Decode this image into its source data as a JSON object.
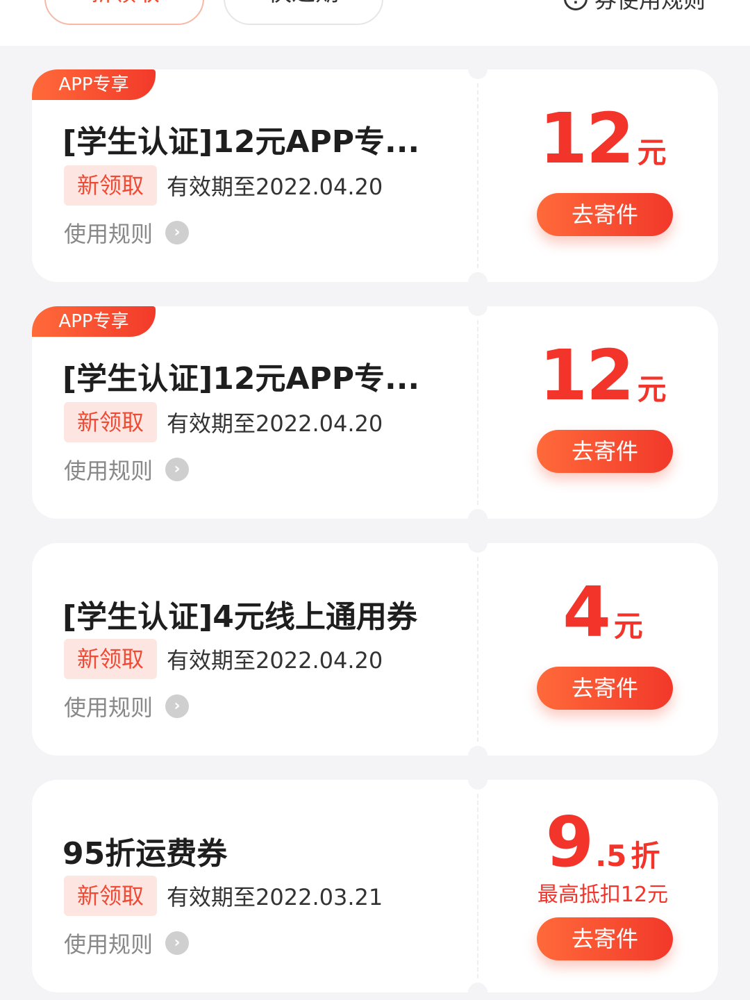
{
  "filters": {
    "new": "新领取",
    "expiring": "快过期"
  },
  "top_rules": {
    "label": "券使用规则",
    "icon": "info-icon"
  },
  "coupons": [
    {
      "badge": "APP专享",
      "title": "[学生认证]12元APP专...",
      "tag": "新领取",
      "expiry": "有效期至2022.04.20",
      "rules": "使用规则",
      "amount": "12",
      "unit": "元",
      "button": "去寄件"
    },
    {
      "badge": "APP专享",
      "title": "[学生认证]12元APP专...",
      "tag": "新领取",
      "expiry": "有效期至2022.04.20",
      "rules": "使用规则",
      "amount": "12",
      "unit": "元",
      "button": "去寄件"
    },
    {
      "title": "[学生认证]4元线上通用券",
      "tag": "新领取",
      "expiry": "有效期至2022.04.20",
      "rules": "使用规则",
      "amount": "4",
      "unit": "元",
      "button": "去寄件"
    },
    {
      "title": "95折运费券",
      "tag": "新领取",
      "expiry": "有效期至2022.03.21",
      "rules": "使用规则",
      "amount": "9",
      "decimal": ".5",
      "unit": "折",
      "limit": "最高抵扣12元",
      "button": "去寄件"
    }
  ],
  "colors": {
    "accent": "#f2342a",
    "tag_bg": "#fde6e2",
    "page_bg": "#f4f4f6"
  }
}
